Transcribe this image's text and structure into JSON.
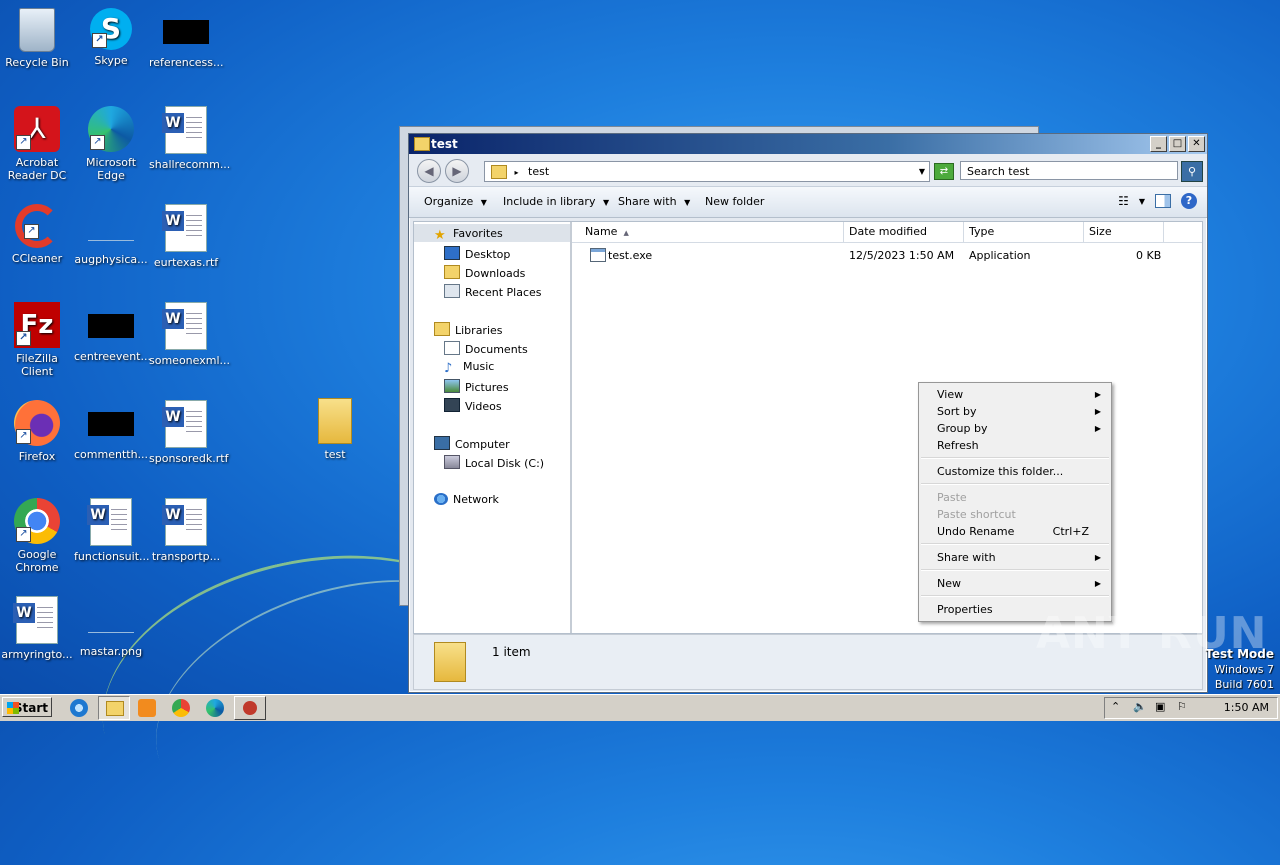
{
  "desktop": {
    "icons": [
      {
        "label": "Recycle Bin"
      },
      {
        "label": "Skype"
      },
      {
        "label": "referencess..."
      },
      {
        "label": "Acrobat Reader DC"
      },
      {
        "label": "Microsoft Edge"
      },
      {
        "label": "shallrecomm..."
      },
      {
        "label": "CCleaner"
      },
      {
        "label": "augphysica..."
      },
      {
        "label": "eurtexas.rtf"
      },
      {
        "label": "FileZilla Client"
      },
      {
        "label": "centreevent..."
      },
      {
        "label": "someonexml..."
      },
      {
        "label": "Firefox"
      },
      {
        "label": "commentth..."
      },
      {
        "label": "sponsoredk.rtf"
      },
      {
        "label": "Google Chrome"
      },
      {
        "label": "functionsuit..."
      },
      {
        "label": "transportp..."
      },
      {
        "label": "armyringto..."
      },
      {
        "label": "mastar.png"
      },
      {
        "label": "test"
      }
    ]
  },
  "window": {
    "title": "test",
    "address": "test",
    "search_placeholder": "Search test",
    "toolbar": {
      "organize": "Organize",
      "include_in_library": "Include in library",
      "share_with": "Share with",
      "new_folder": "New folder"
    },
    "nav": {
      "favorites": "Favorites",
      "desktop": "Desktop",
      "downloads": "Downloads",
      "recent_places": "Recent Places",
      "libraries": "Libraries",
      "documents": "Documents",
      "music": "Music",
      "pictures": "Pictures",
      "videos": "Videos",
      "computer": "Computer",
      "local_disk": "Local Disk (C:)",
      "network": "Network"
    },
    "columns": {
      "name": "Name",
      "date_modified": "Date modified",
      "type": "Type",
      "size": "Size"
    },
    "files": [
      {
        "name": "test.exe",
        "date_modified": "12/5/2023 1:50 AM",
        "type": "Application",
        "size": "0 KB"
      }
    ],
    "status": "1 item"
  },
  "context_menu": {
    "view": "View",
    "sort_by": "Sort by",
    "group_by": "Group by",
    "refresh": "Refresh",
    "customize": "Customize this folder...",
    "paste": "Paste",
    "paste_shortcut": "Paste shortcut",
    "undo_rename": "Undo Rename",
    "undo_shortcut": "Ctrl+Z",
    "share_with": "Share with",
    "new": "New",
    "properties": "Properties"
  },
  "watermark": "ANY RUN",
  "test_mode": {
    "line1": "Test Mode",
    "line2": "Windows 7",
    "line3": "Build 7601"
  },
  "taskbar": {
    "start": "Start",
    "clock": "1:50 AM"
  }
}
